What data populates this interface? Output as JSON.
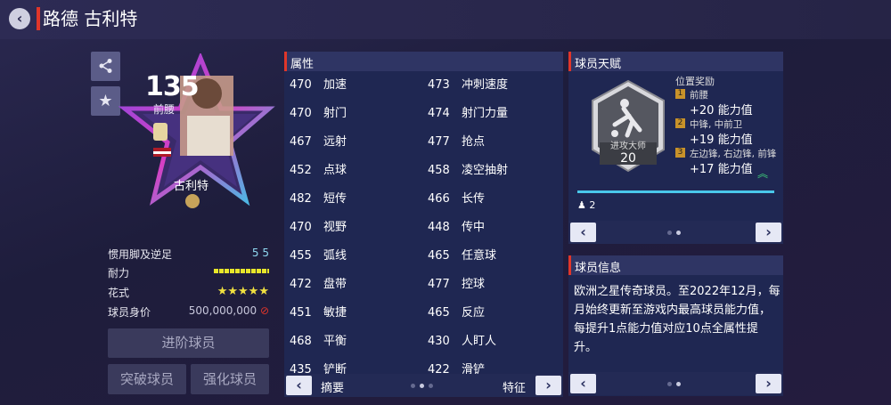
{
  "header": {
    "title": "路德 古利特"
  },
  "card": {
    "rating": "135",
    "position": "前腰",
    "name": "古利特"
  },
  "player_stats": [
    {
      "label": "惯用脚及逆足",
      "value": "5 5"
    },
    {
      "label": "耐力",
      "value": ""
    },
    {
      "label": "花式",
      "value": "★★★★★"
    },
    {
      "label": "球员身价",
      "value": "500,000,000"
    }
  ],
  "buttons": {
    "advance": "进阶球员",
    "breakthrough": "突破球员",
    "enhance": "强化球员"
  },
  "attributes": {
    "title": "属性",
    "left": [
      {
        "v": "470",
        "n": "加速"
      },
      {
        "v": "470",
        "n": "射门"
      },
      {
        "v": "467",
        "n": "远射"
      },
      {
        "v": "452",
        "n": "点球"
      },
      {
        "v": "482",
        "n": "短传"
      },
      {
        "v": "470",
        "n": "视野"
      },
      {
        "v": "455",
        "n": "弧线"
      },
      {
        "v": "472",
        "n": "盘带"
      },
      {
        "v": "451",
        "n": "敏捷"
      },
      {
        "v": "468",
        "n": "平衡"
      },
      {
        "v": "435",
        "n": "铲断"
      }
    ],
    "right": [
      {
        "v": "473",
        "n": "冲刺速度"
      },
      {
        "v": "474",
        "n": "射门力量"
      },
      {
        "v": "477",
        "n": "抢点"
      },
      {
        "v": "458",
        "n": "凌空抽射"
      },
      {
        "v": "466",
        "n": "长传"
      },
      {
        "v": "448",
        "n": "传中"
      },
      {
        "v": "465",
        "n": "任意球"
      },
      {
        "v": "477",
        "n": "控球"
      },
      {
        "v": "465",
        "n": "反应"
      },
      {
        "v": "430",
        "n": "人盯人"
      },
      {
        "v": "422",
        "n": "滑铲"
      }
    ],
    "nav_left": "摘要",
    "nav_right": "特征"
  },
  "talent": {
    "title": "球员天赋",
    "badge_name": "进攻大师",
    "badge_level": "20",
    "bonus_title": "位置奖励",
    "bonuses": [
      {
        "rank": "1",
        "positions": "前腰",
        "value": "+20 能力值"
      },
      {
        "rank": "2",
        "positions": "中锋, 中前卫",
        "value": "+19 能力值"
      },
      {
        "rank": "3",
        "positions": "左边锋, 右边锋, 前锋",
        "value": "+17 能力值"
      }
    ],
    "count": "2"
  },
  "info": {
    "title": "球员信息",
    "text": "欧洲之星传奇球员。至2022年12月，每月始终更新至游戏内最高球员能力值，每提升1点能力值对应10点全属性提升。"
  }
}
